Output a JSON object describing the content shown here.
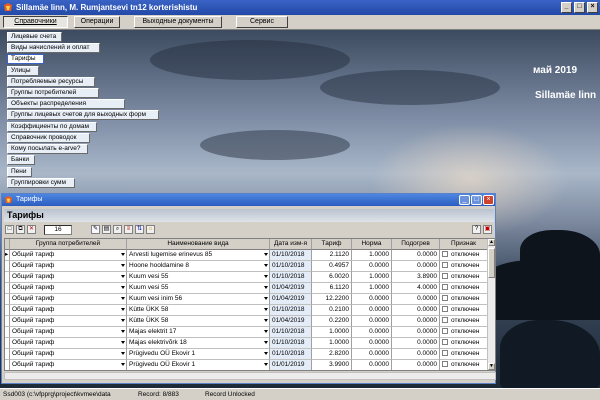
{
  "app": {
    "title": "Sillamäe linn, M. Rumjantsevi tn12 korterishistu"
  },
  "menu": [
    {
      "label": "Справочники",
      "active": true
    },
    {
      "label": "Операции"
    },
    {
      "label": "Выходные документы"
    },
    {
      "label": "Сервис"
    }
  ],
  "left_menu": [
    {
      "label": "Лицевые счета"
    },
    {
      "label": "Виды начислений и оплат"
    },
    {
      "label": "Тарифы",
      "selected": true
    },
    {
      "label": "Улицы"
    },
    {
      "label": "Потребляемые ресурсы"
    },
    {
      "label": "Группы потребителей"
    },
    {
      "label": "Объекты распределения"
    },
    {
      "label": "Группы лицевых счетов  для выходных форм"
    },
    {
      "label": "Коэффициенты по домам"
    },
    {
      "label": "Справочник проводок"
    },
    {
      "label": "Кому посылать e-arve?"
    },
    {
      "label": "Банки"
    },
    {
      "label": "Пени"
    },
    {
      "label": "Группировки сумм"
    }
  ],
  "desktop": {
    "month": "май 2019",
    "city": "Sillamäe linn"
  },
  "child_window": {
    "title": "Тарифы",
    "heading": "Тарифы",
    "record_count": "16",
    "columns": [
      "Группа потребителей",
      "Наименование вида",
      "Дата изм-я",
      "Тариф",
      "Норма",
      "Подогрев",
      "Признак"
    ],
    "rows": [
      [
        "Общий тариф",
        "Arvesti lugemise erinevus  85",
        "01/10/2018",
        "2.1120",
        "1.0000",
        "0.0000",
        "отключен"
      ],
      [
        "Общий тариф",
        "Hoone hooldamine  8",
        "01/10/2018",
        "0.4957",
        "0.0000",
        "0.0000",
        "отключен"
      ],
      [
        "Общий тариф",
        "Kuum vesi  55",
        "01/10/2018",
        "6.0020",
        "1.0000",
        "3.8900",
        "отключен"
      ],
      [
        "Общий тариф",
        "Kuum vesi  55",
        "01/04/2019",
        "6.1120",
        "1.0000",
        "4.0000",
        "отключен"
      ],
      [
        "Общий тариф",
        "Kuum vesi inim  56",
        "01/04/2019",
        "12.2200",
        "0.0000",
        "0.0000",
        "отключен"
      ],
      [
        "Общий тариф",
        "Kütte ÜKK  58",
        "01/10/2018",
        "0.2100",
        "0.0000",
        "0.0000",
        "отключен"
      ],
      [
        "Общий тариф",
        "Kütte ÜKK  58",
        "01/04/2019",
        "0.2200",
        "0.0000",
        "0.0000",
        "отключен"
      ],
      [
        "Общий тариф",
        "Majas elektrit  17",
        "01/10/2018",
        "1.0000",
        "0.0000",
        "0.0000",
        "отключен"
      ],
      [
        "Общий тариф",
        "Majas elektrivõrk  18",
        "01/10/2018",
        "1.0000",
        "0.0000",
        "0.0000",
        "отключен"
      ],
      [
        "Общий тариф",
        "Prügivedu OÜ Ekovir  1",
        "01/10/2018",
        "2.8200",
        "0.0000",
        "0.0000",
        "отключен"
      ],
      [
        "Общий тариф",
        "Prügivedu OÜ Ekovir  1",
        "01/01/2019",
        "3.9900",
        "0.0000",
        "0.0000",
        "отключен"
      ]
    ]
  },
  "status": {
    "left": "Ssd003 (c:\\vfpprg\\project\\kvmee\\data",
    "record": "Record: 8/883",
    "lock": "Record Unlocked"
  }
}
